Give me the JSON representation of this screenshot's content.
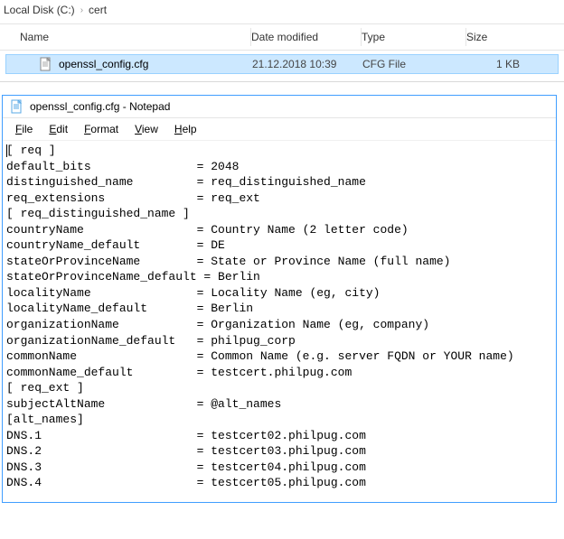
{
  "breadcrumb": {
    "part1": "Local Disk (C:)",
    "part2": "cert"
  },
  "explorer": {
    "headers": {
      "name": "Name",
      "date": "Date modified",
      "type": "Type",
      "size": "Size"
    },
    "file": {
      "name": "openssl_config.cfg",
      "date": "21.12.2018 10:39",
      "type": "CFG File",
      "size": "1 KB"
    }
  },
  "notepad": {
    "title": "openssl_config.cfg - Notepad",
    "menu": {
      "file": "File",
      "edit": "Edit",
      "format": "Format",
      "view": "View",
      "help": "Help"
    },
    "lines": [
      {
        "raw": "[ req ]"
      },
      {
        "key": "default_bits",
        "val": "2048"
      },
      {
        "key": "distinguished_name",
        "val": "req_distinguished_name"
      },
      {
        "key": "req_extensions",
        "val": "req_ext"
      },
      {
        "raw": "[ req_distinguished_name ]"
      },
      {
        "key": "countryName",
        "val": "Country Name (2 letter code)"
      },
      {
        "key": "countryName_default",
        "val": "DE"
      },
      {
        "key": "stateOrProvinceName",
        "val": "State or Province Name (full name)"
      },
      {
        "key": "stateOrProvinceName_default",
        "val": "Berlin"
      },
      {
        "key": "localityName",
        "val": "Locality Name (eg, city)"
      },
      {
        "key": "localityName_default",
        "val": "Berlin"
      },
      {
        "key": "organizationName",
        "val": "Organization Name (eg, company)"
      },
      {
        "key": "organizationName_default",
        "val": "philpug_corp"
      },
      {
        "key": "commonName",
        "val": "Common Name (e.g. server FQDN or YOUR name)"
      },
      {
        "key": "commonName_default",
        "val": "testcert.philpug.com"
      },
      {
        "raw": "[ req_ext ]"
      },
      {
        "key": "subjectAltName",
        "val": "@alt_names"
      },
      {
        "raw": "[alt_names]"
      },
      {
        "key": "DNS.1",
        "val": "testcert02.philpug.com"
      },
      {
        "key": "DNS.2",
        "val": "testcert03.philpug.com"
      },
      {
        "key": "DNS.3",
        "val": "testcert04.philpug.com"
      },
      {
        "key": "DNS.4",
        "val": "testcert05.philpug.com"
      }
    ],
    "key_col_width": 27
  }
}
